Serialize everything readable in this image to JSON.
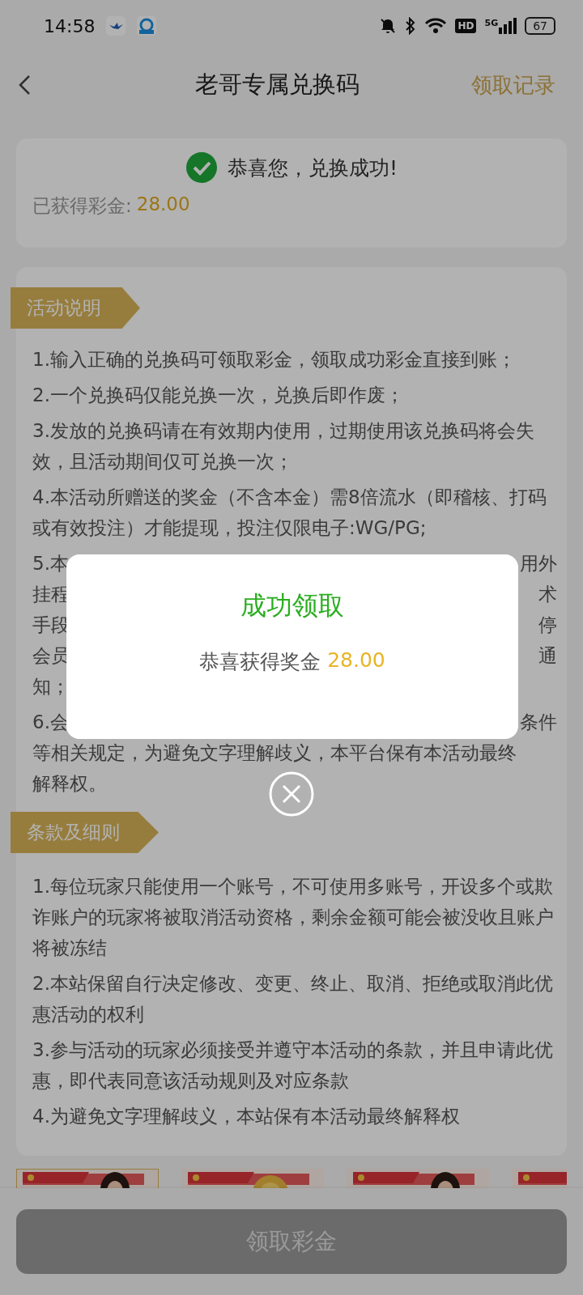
{
  "status_bar": {
    "time": "14:58",
    "hd": "HD",
    "network": "5G",
    "battery": "67"
  },
  "header": {
    "title": "老哥专属兑换码",
    "action": "领取记录"
  },
  "result_card": {
    "message": "恭喜您，兑换成功!",
    "bonus_label": "已获得彩金:",
    "bonus_value": "28.00"
  },
  "sections": [
    {
      "title": "活动说明",
      "items": [
        {
          "kind": "text",
          "text": "1.输入正确的兑换码可领取彩金，领取成功彩金直接到账；"
        },
        {
          "kind": "text",
          "text": "2.一个兑换码仅能兑换一次，兑换后即作废；"
        },
        {
          "kind": "text",
          "text": "3.发放的兑换码请在有效期内使用，过期使用该兑换码将会失效，且活动期间仅可兑换一次；"
        },
        {
          "kind": "text",
          "text": "4.本活动所赠送的奖金（不含本金）需8倍流水（即稽核、打码或有效投注）才能提现，投注仅限电子:WG/PG;"
        },
        {
          "kind": "partial",
          "lines": [
            [
              "5.本",
              "用外"
            ],
            [
              "挂程",
              "术"
            ],
            [
              "手段",
              "停"
            ],
            [
              "会员",
              "通"
            ],
            [
              "知；"
            ]
          ]
        },
        {
          "kind": "partial",
          "lines": [
            [
              "6.会",
              "条件"
            ],
            [
              "等相关规定，为避免文字理解歧义，本平台保有本活动最终"
            ],
            [
              "解释权。"
            ]
          ]
        }
      ]
    },
    {
      "title": "条款及细则",
      "items": [
        {
          "kind": "text",
          "text": "1.每位玩家只能使用一个账号，不可使用多账号，开设多个或欺诈账户的玩家将被取消活动资格，剩余金额可能会被没收且账户将被冻结"
        },
        {
          "kind": "text",
          "text": "2.本站保留自行决定修改、变更、终止、取消、拒绝或取消此优惠活动的权利"
        },
        {
          "kind": "text",
          "text": "3.参与活动的玩家必须接受并遵守本活动的条款，并且申请此优惠，即代表同意该活动规则及对应条款"
        },
        {
          "kind": "text",
          "text": "4.为避免文字理解歧义，本站保有本活动最终解释权"
        }
      ]
    }
  ],
  "button": {
    "label": "领取彩金",
    "disabled": true
  },
  "dialog": {
    "title": "成功领取",
    "message": "恭喜获得奖金",
    "amount": "28.00"
  }
}
